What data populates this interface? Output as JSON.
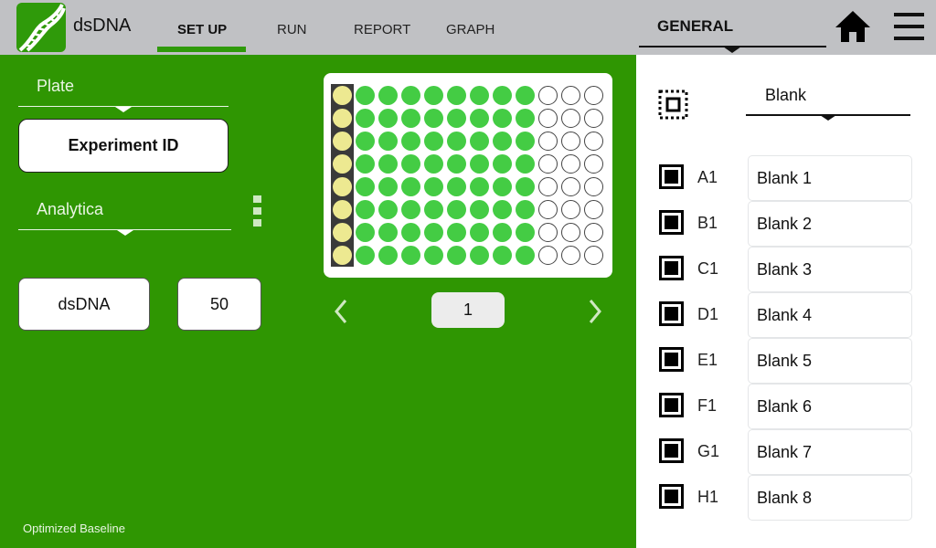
{
  "app": {
    "title": "dsDNA",
    "logo_icon": "dna-icon"
  },
  "tabs": [
    {
      "label": "SET UP",
      "active": true
    },
    {
      "label": "RUN",
      "active": false
    },
    {
      "label": "REPORT",
      "active": false
    },
    {
      "label": "GRAPH",
      "active": false
    }
  ],
  "header": {
    "section": "GENERAL",
    "home_icon": "home-icon",
    "menu_icon": "hamburger-menu-icon"
  },
  "left": {
    "plate_dropdown": "Plate",
    "experiment_button": "Experiment ID",
    "analytica_dropdown": "Analytica",
    "assay_field": "dsDNA",
    "value_field": "50",
    "footer": "Optimized Baseline"
  },
  "plate": {
    "rows": 8,
    "columns": 12,
    "column_states": [
      "selected-blank",
      "sample",
      "sample",
      "sample",
      "sample",
      "sample",
      "sample",
      "sample",
      "sample",
      "empty",
      "empty",
      "empty"
    ],
    "colors": {
      "blank": "#ede991",
      "sample": "#44cc44",
      "empty": "#ffffff",
      "frame": "#3a3a3a"
    },
    "page": "1",
    "prev_icon": "chevron-left-icon",
    "next_icon": "chevron-right-icon"
  },
  "right": {
    "type_dropdown": "Blank",
    "select_icon": "select-all-icon",
    "wells": [
      {
        "id": "A1",
        "name": "Blank 1",
        "checked": true
      },
      {
        "id": "B1",
        "name": "Blank 2",
        "checked": true
      },
      {
        "id": "C1",
        "name": "Blank 3",
        "checked": true
      },
      {
        "id": "D1",
        "name": "Blank 4",
        "checked": true
      },
      {
        "id": "E1",
        "name": "Blank 5",
        "checked": true
      },
      {
        "id": "F1",
        "name": "Blank 6",
        "checked": true
      },
      {
        "id": "G1",
        "name": "Blank 7",
        "checked": true
      },
      {
        "id": "H1",
        "name": "Blank 8",
        "checked": true
      }
    ]
  }
}
